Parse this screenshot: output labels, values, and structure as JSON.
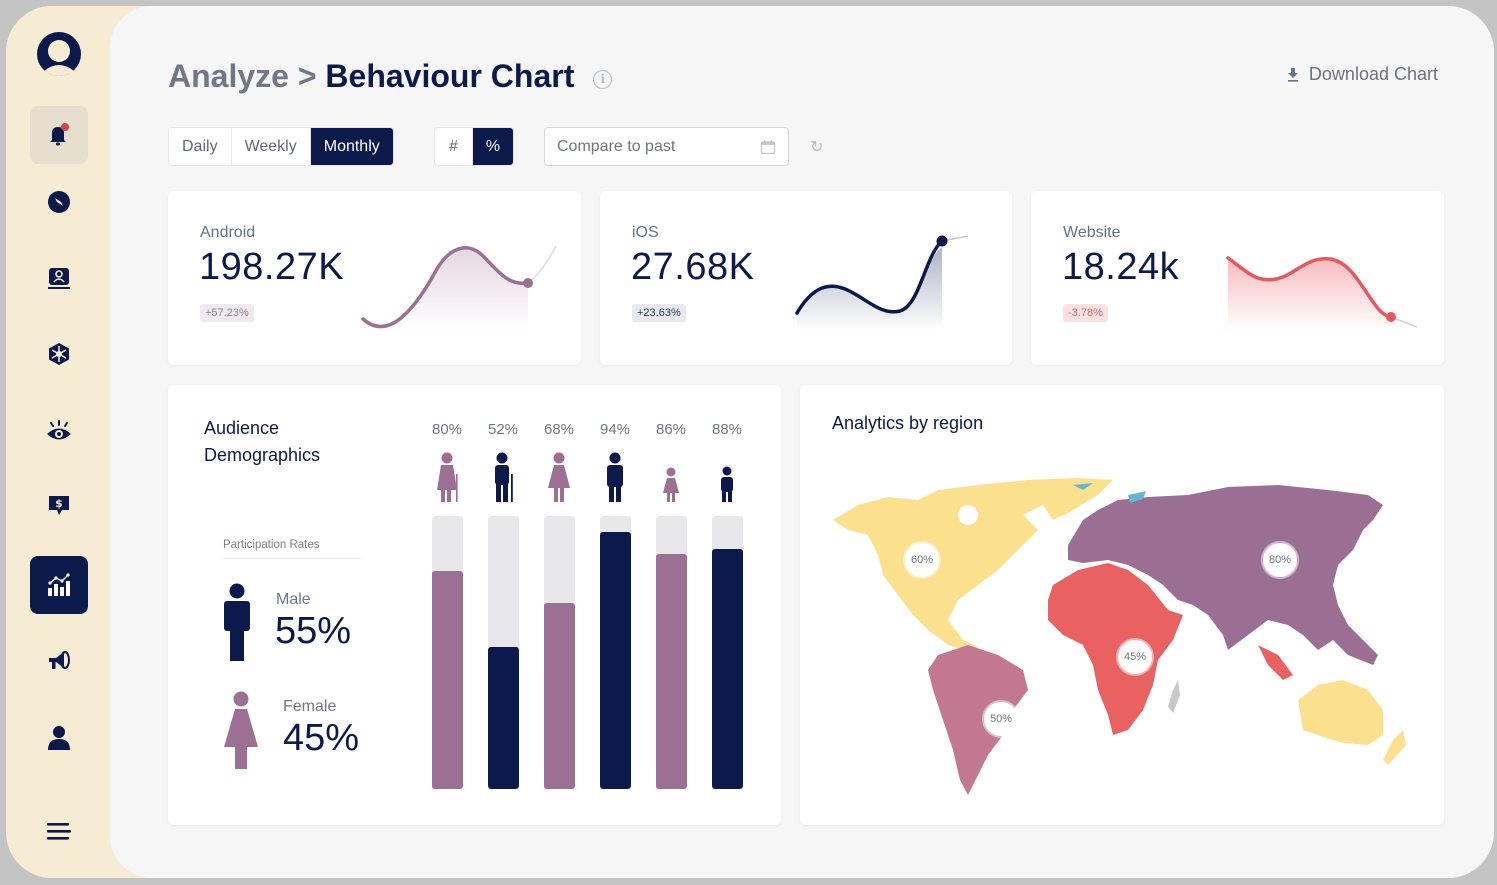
{
  "header": {
    "breadcrumb_parent": "Analyze",
    "breadcrumb_sep": ">",
    "page_title": "Behaviour Chart",
    "info_icon": "i",
    "download_label": "Download Chart"
  },
  "sidebar": {
    "items": [
      {
        "name": "profile",
        "icon": "user-circle-icon"
      },
      {
        "name": "notifications",
        "icon": "bell-icon",
        "state": "highlight",
        "has_badge": true
      },
      {
        "name": "explore",
        "icon": "compass-icon"
      },
      {
        "name": "contacts",
        "icon": "contact-card-icon"
      },
      {
        "name": "network",
        "icon": "network-icon"
      },
      {
        "name": "visibility",
        "icon": "eye-icon"
      },
      {
        "name": "billing",
        "icon": "dollar-chat-icon"
      },
      {
        "name": "analyze",
        "icon": "chart-icon",
        "state": "active"
      },
      {
        "name": "campaigns",
        "icon": "megaphone-icon"
      },
      {
        "name": "account",
        "icon": "person-icon"
      },
      {
        "name": "menu",
        "icon": "hamburger-icon"
      }
    ]
  },
  "controls": {
    "period_options": [
      "Daily",
      "Weekly",
      "Monthly"
    ],
    "period_selected": "Monthly",
    "unit_options": [
      "#",
      "%"
    ],
    "unit_selected": "%",
    "compare_placeholder": "Compare to past",
    "refresh_icon": "↻"
  },
  "stats": [
    {
      "label": "Android",
      "value": "198.27K",
      "change": "+57.23%",
      "trend": "positive",
      "color": "#9b7092"
    },
    {
      "label": "iOS",
      "value": "27.68K",
      "change": "+23.63%",
      "trend": "positive",
      "color": "#0b1a4a"
    },
    {
      "label": "Website",
      "value": "18.24k",
      "change": "-3.78%",
      "trend": "negative",
      "color": "#e8585e"
    }
  ],
  "demographics": {
    "title": "Audience Demographics",
    "participation_label": "Participation Rates",
    "male_label": "Male",
    "male_value": "55%",
    "female_label": "Female",
    "female_value": "45%",
    "groups": [
      {
        "name": "elderly-female",
        "pct_label": "80%",
        "value": 80,
        "color": "#9b7092"
      },
      {
        "name": "elderly-male",
        "pct_label": "52%",
        "value": 52,
        "color": "#0b1a4a"
      },
      {
        "name": "adult-female",
        "pct_label": "68%",
        "value": 68,
        "color": "#9b7092"
      },
      {
        "name": "adult-male",
        "pct_label": "94%",
        "value": 94,
        "color": "#0b1a4a"
      },
      {
        "name": "girl",
        "pct_label": "86%",
        "value": 86,
        "color": "#9b7092"
      },
      {
        "name": "boy",
        "pct_label": "88%",
        "value": 88,
        "color": "#0b1a4a"
      }
    ]
  },
  "regions": {
    "title": "Analytics by region",
    "items": [
      {
        "region": "North America",
        "label": "60%",
        "color": "#fbe08e"
      },
      {
        "region": "South America",
        "label": "50%",
        "color": "#c27890"
      },
      {
        "region": "Africa",
        "label": "45%",
        "color": "#ea6161"
      },
      {
        "region": "Eurasia",
        "label": "80%",
        "color": "#9a6f93"
      },
      {
        "region": "Oceania",
        "label": "",
        "color": "#fbe08e"
      }
    ]
  }
}
